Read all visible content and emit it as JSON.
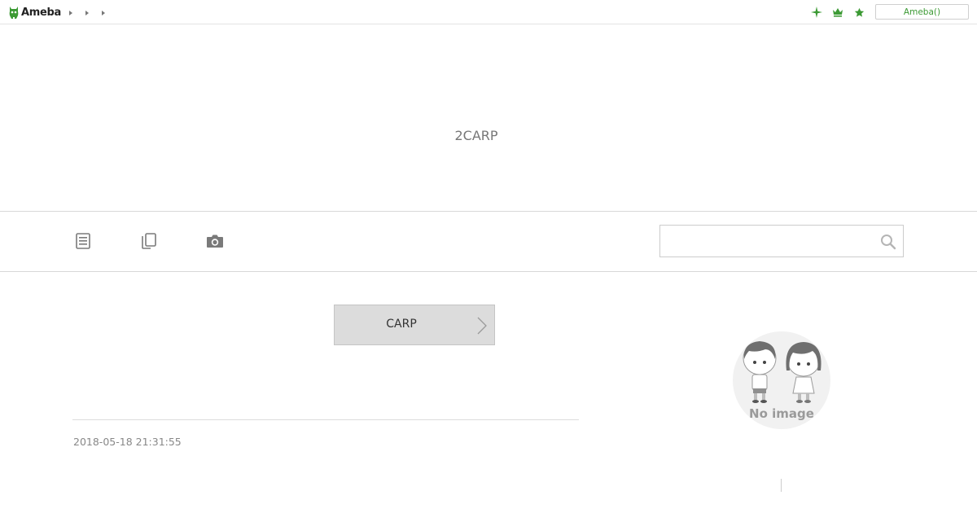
{
  "topbar": {
    "logo_text": "Ameba",
    "brand_color": "#3c9a34",
    "crumb_icons": [
      "caret-right-icon",
      "caret-right-icon",
      "caret-right-icon"
    ],
    "right_icons": [
      "sparkle-icon",
      "crown-icon",
      "star-icon"
    ],
    "login_label": "Ameba()"
  },
  "blog": {
    "title": "2CARP"
  },
  "nav": {
    "items": [
      {
        "icon": "article-list-icon"
      },
      {
        "icon": "pages-icon"
      },
      {
        "icon": "camera-icon"
      }
    ],
    "search_placeholder": "",
    "search_icon": "search-icon"
  },
  "main": {
    "theme_label": "CARP",
    "post_date": "2018-05-18 21:31:55"
  },
  "sidebar": {
    "profile_image_label": "No image"
  }
}
